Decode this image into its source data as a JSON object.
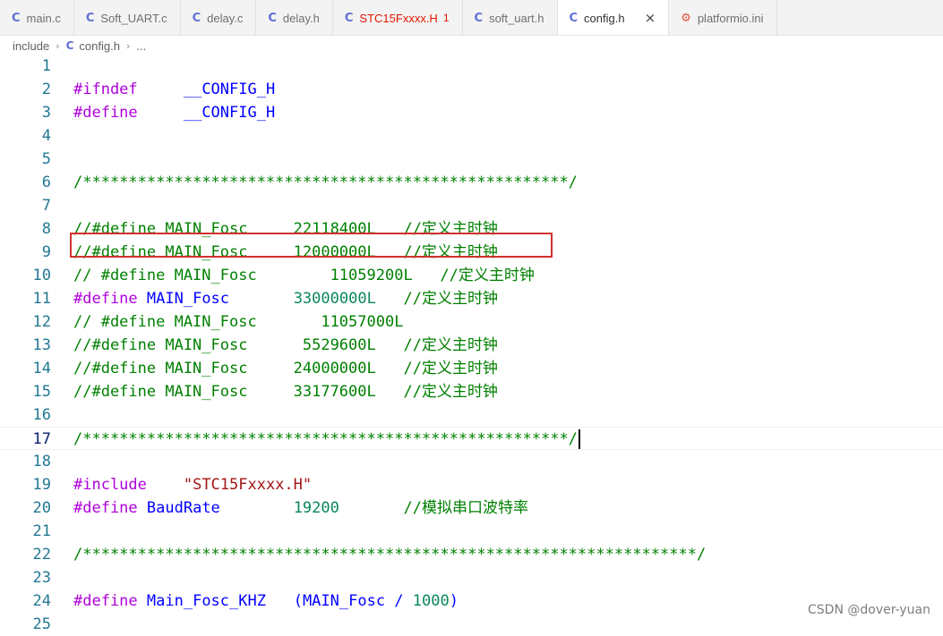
{
  "tabs": [
    {
      "icon": "C",
      "label": "main.c"
    },
    {
      "icon": "C",
      "label": "Soft_UART.c"
    },
    {
      "icon": "C",
      "label": "delay.c"
    },
    {
      "icon": "C",
      "label": "delay.h"
    },
    {
      "icon": "C",
      "label": "STC15Fxxxx.H",
      "problems": "1"
    },
    {
      "icon": "C",
      "label": "soft_uart.h"
    },
    {
      "icon": "C",
      "label": "config.h",
      "close": "×"
    },
    {
      "icon": "⚙",
      "label": "platformio.ini"
    }
  ],
  "breadcrumb": {
    "folder": "include",
    "file_icon": "C",
    "file": "config.h",
    "more": "..."
  },
  "editor": {
    "current_line": 17,
    "lines": [
      {
        "n": "1",
        "t": []
      },
      {
        "n": "2",
        "t": [
          [
            "#ifndef",
            "pp"
          ],
          [
            "     ",
            "plain"
          ],
          [
            "__CONFIG_H",
            "id"
          ]
        ]
      },
      {
        "n": "3",
        "t": [
          [
            "#define",
            "pp"
          ],
          [
            "     ",
            "plain"
          ],
          [
            "__CONFIG_H",
            "id"
          ]
        ]
      },
      {
        "n": "4",
        "t": []
      },
      {
        "n": "5",
        "t": []
      },
      {
        "n": "6",
        "t": [
          [
            "/*****************************************************/",
            "cmt"
          ]
        ]
      },
      {
        "n": "7",
        "t": []
      },
      {
        "n": "8",
        "t": [
          [
            "//#define MAIN_Fosc     22118400L   //定义主时钟",
            "cmt"
          ]
        ]
      },
      {
        "n": "9",
        "t": [
          [
            "//#define MAIN_Fosc     12000000L   //定义主时钟",
            "cmt"
          ]
        ]
      },
      {
        "n": "10",
        "t": [
          [
            "// #define MAIN_Fosc        11059200L   //定义主时钟",
            "cmt"
          ]
        ]
      },
      {
        "n": "11",
        "t": [
          [
            "#define",
            "pp"
          ],
          [
            " ",
            "plain"
          ],
          [
            "MAIN_Fosc",
            "id"
          ],
          [
            "       ",
            "plain"
          ],
          [
            "33000000L",
            "num"
          ],
          [
            "   ",
            "plain"
          ],
          [
            "//定义主时钟",
            "cmt"
          ]
        ]
      },
      {
        "n": "12",
        "t": [
          [
            "// #define MAIN_Fosc       11057000L",
            "cmt"
          ]
        ]
      },
      {
        "n": "13",
        "t": [
          [
            "//#define MAIN_Fosc      5529600L   //定义主时钟",
            "cmt"
          ]
        ]
      },
      {
        "n": "14",
        "t": [
          [
            "//#define MAIN_Fosc     24000000L   //定义主时钟",
            "cmt"
          ]
        ]
      },
      {
        "n": "15",
        "t": [
          [
            "//#define MAIN_Fosc     33177600L   //定义主时钟",
            "cmt"
          ]
        ]
      },
      {
        "n": "16",
        "t": []
      },
      {
        "n": "17",
        "t": [
          [
            "/*****************************************************/",
            "cmt"
          ]
        ]
      },
      {
        "n": "18",
        "t": []
      },
      {
        "n": "19",
        "t": [
          [
            "#include",
            "pp"
          ],
          [
            "    ",
            "plain"
          ],
          [
            "\"STC15Fxxxx.H\"",
            "str"
          ]
        ]
      },
      {
        "n": "20",
        "t": [
          [
            "#define",
            "pp"
          ],
          [
            " ",
            "plain"
          ],
          [
            "BaudRate",
            "id"
          ],
          [
            "        ",
            "plain"
          ],
          [
            "19200",
            "num"
          ],
          [
            "       ",
            "plain"
          ],
          [
            "//模拟串口波特率",
            "cmt"
          ]
        ]
      },
      {
        "n": "21",
        "t": []
      },
      {
        "n": "22",
        "t": [
          [
            "/*******************************************************************/",
            "cmt"
          ]
        ]
      },
      {
        "n": "23",
        "t": []
      },
      {
        "n": "24",
        "t": [
          [
            "#define",
            "pp"
          ],
          [
            " ",
            "plain"
          ],
          [
            "Main_Fosc_KHZ",
            "id"
          ],
          [
            "   ",
            "plain"
          ],
          [
            "(",
            "id"
          ],
          [
            "MAIN_Fosc",
            "id"
          ],
          [
            " / ",
            "id"
          ],
          [
            "1000",
            "num"
          ],
          [
            ")",
            "id"
          ]
        ]
      },
      {
        "n": "25",
        "t": []
      }
    ]
  },
  "watermark": "CSDN @dover-yuan",
  "colors": {
    "preprocessor": "#af00db",
    "identifier": "#0000ff",
    "comment": "#008000",
    "number": "#098658",
    "string": "#a31515",
    "line_number": "#237893",
    "highlight_box": "#d03030"
  }
}
